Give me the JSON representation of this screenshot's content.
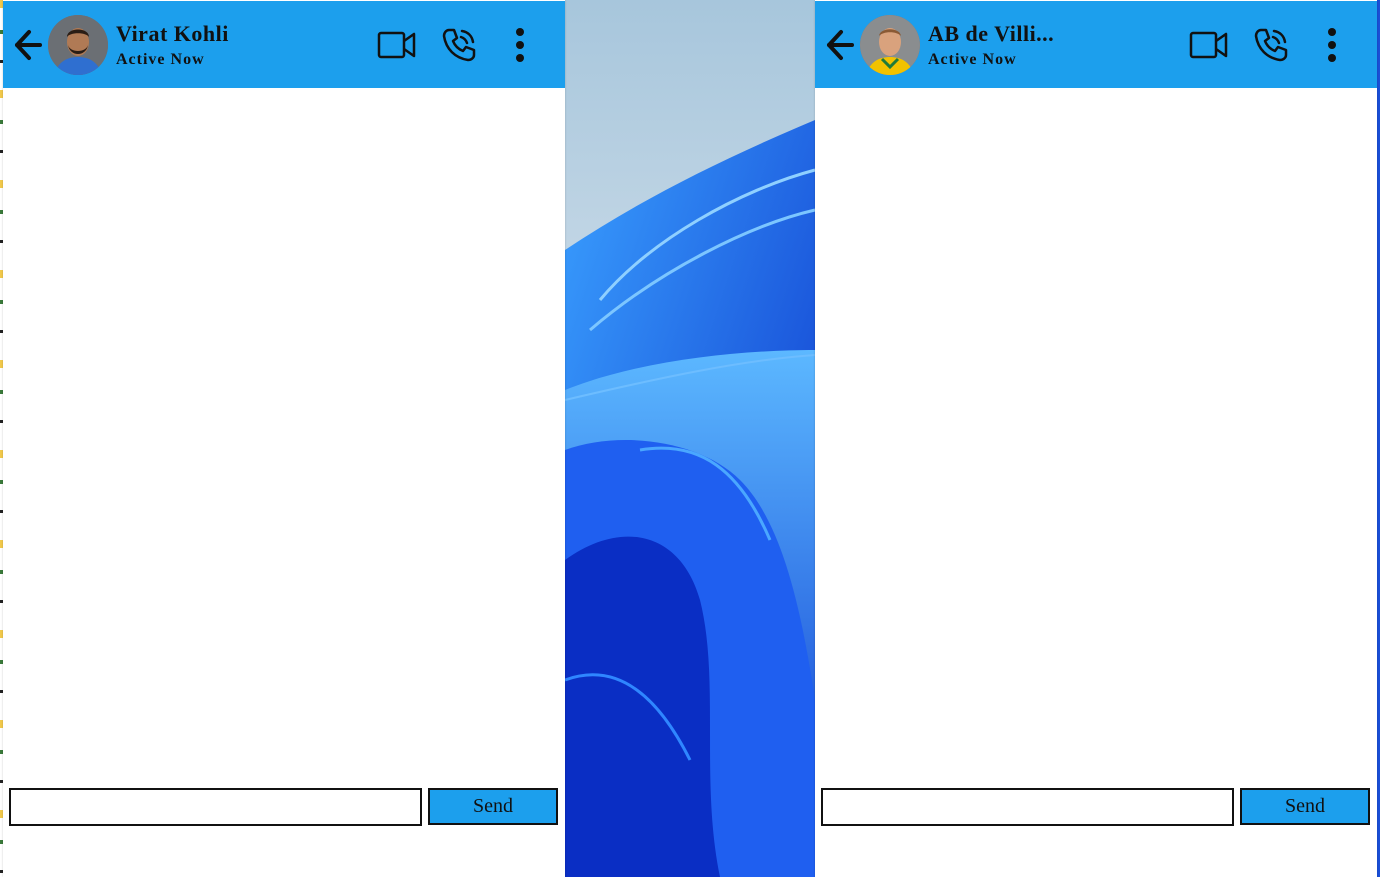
{
  "chats": [
    {
      "contact_name": "Virat Kohli",
      "status": "Active Now",
      "input_value": "",
      "send_label": "Send",
      "avatar_colors": {
        "shirt": "#2f6fd0",
        "skin": "#b07a55",
        "hair": "#2a1d15"
      }
    },
    {
      "contact_name": "AB de Villi...",
      "status": "Active Now",
      "input_value": "",
      "send_label": "Send",
      "avatar_colors": {
        "shirt": "#f2c200",
        "skin": "#d9a27d",
        "hair": "#8a5a35"
      }
    }
  ],
  "colors": {
    "header": "#1c9fed",
    "send_button": "#1c9fed",
    "panel": "#ffffff"
  },
  "icons": [
    "back-arrow-icon",
    "video-camera-icon",
    "phone-icon",
    "more-vertical-icon"
  ]
}
